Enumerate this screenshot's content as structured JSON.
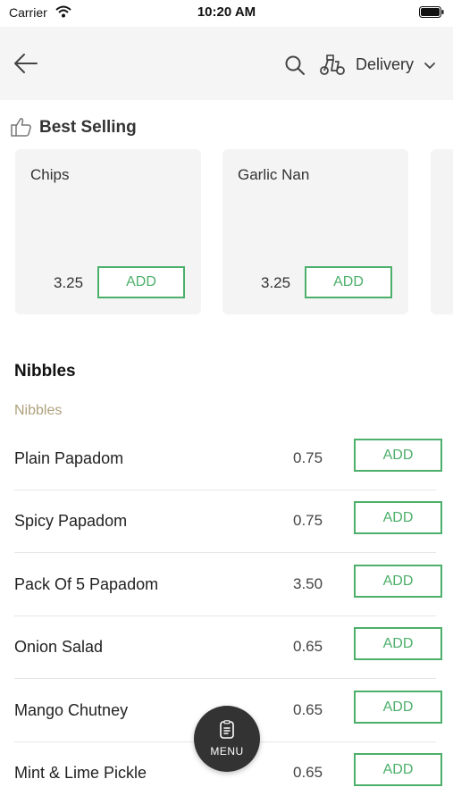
{
  "status_bar": {
    "carrier": "Carrier",
    "time": "10:20 AM"
  },
  "nav": {
    "delivery_label": "Delivery"
  },
  "best_selling": {
    "title": "Best Selling",
    "items": [
      {
        "name": "Chips",
        "price": "3.25",
        "add_label": "ADD"
      },
      {
        "name": "Garlic Nan",
        "price": "3.25",
        "add_label": "ADD"
      }
    ]
  },
  "section": {
    "title": "Nibbles",
    "subtitle": "Nibbles"
  },
  "menu_items": [
    {
      "name": "Plain Papadom",
      "price": "0.75",
      "add_label": "ADD"
    },
    {
      "name": "Spicy Papadom",
      "price": "0.75",
      "add_label": "ADD"
    },
    {
      "name": "Pack Of 5 Papadom",
      "price": "3.50",
      "add_label": "ADD"
    },
    {
      "name": "Onion Salad",
      "price": "0.65",
      "add_label": "ADD"
    },
    {
      "name": "Mango Chutney",
      "price": "0.65",
      "add_label": "ADD"
    },
    {
      "name": "Mint & Lime Pickle",
      "price": "0.65",
      "add_label": "ADD"
    }
  ],
  "fab": {
    "label": "MENU"
  },
  "colors": {
    "accent_green": "#4caf6a",
    "subtitle_tan": "#b0a17e",
    "fab_bg": "#333333",
    "card_bg": "#f4f4f4"
  }
}
